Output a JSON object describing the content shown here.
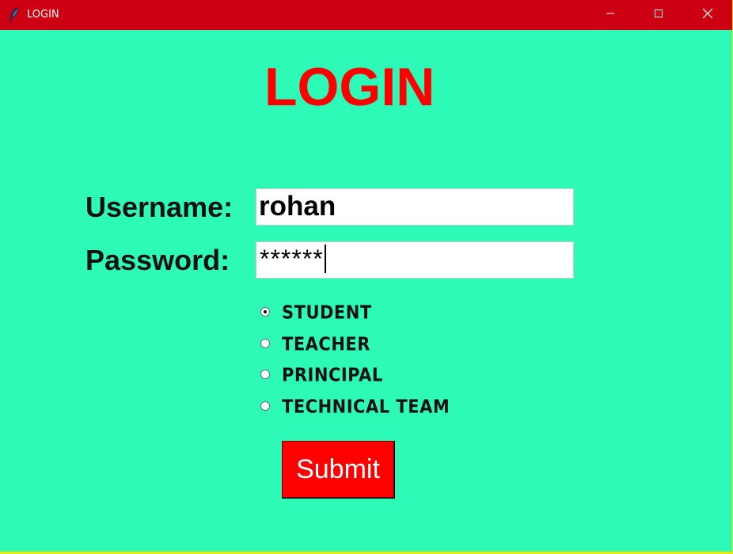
{
  "window": {
    "title": "LOGIN",
    "titlebar_color": "#cc0012",
    "background_color": "#2dfab6",
    "controls": {
      "minimize_icon": "minimize-icon",
      "maximize_icon": "maximize-icon",
      "close_icon": "close-icon"
    }
  },
  "form": {
    "heading": "LOGIN",
    "heading_color": "#ff0000",
    "username_label": "Username:",
    "username_value": "rohan",
    "password_label": "Password:",
    "password_value": "******",
    "roles": [
      {
        "label": "STUDENT",
        "checked": true
      },
      {
        "label": "TEACHER",
        "checked": false
      },
      {
        "label": "PRINCIPAL",
        "checked": false
      },
      {
        "label": "TECHNICAL TEAM",
        "checked": false
      }
    ],
    "submit_label": "Submit",
    "submit_color": "#ff0000"
  }
}
